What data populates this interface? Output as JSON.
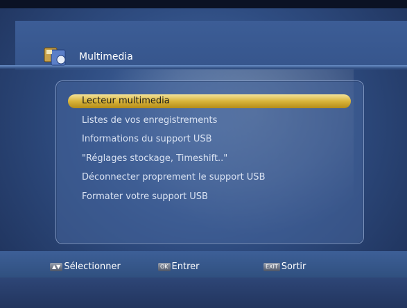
{
  "header": {
    "title": "Multimedia"
  },
  "menu": {
    "items": [
      {
        "label": "Lecteur multimedia",
        "selected": true
      },
      {
        "label": "Listes de vos enregistrements",
        "selected": false
      },
      {
        "label": "Informations du support USB",
        "selected": false
      },
      {
        "label": "\"Réglages stockage, Timeshift..\"",
        "selected": false
      },
      {
        "label": "Déconnecter proprement le support USB",
        "selected": false
      },
      {
        "label": "Formater votre support USB",
        "selected": false
      }
    ]
  },
  "footer": {
    "select": {
      "key": "▲▼",
      "label": "Sélectionner"
    },
    "enter": {
      "key": "OK",
      "label": "Entrer"
    },
    "exit": {
      "key": "EXIT",
      "label": "Sortir"
    }
  },
  "colors": {
    "selection": "#d8b43a",
    "background": "#2f4d82"
  }
}
